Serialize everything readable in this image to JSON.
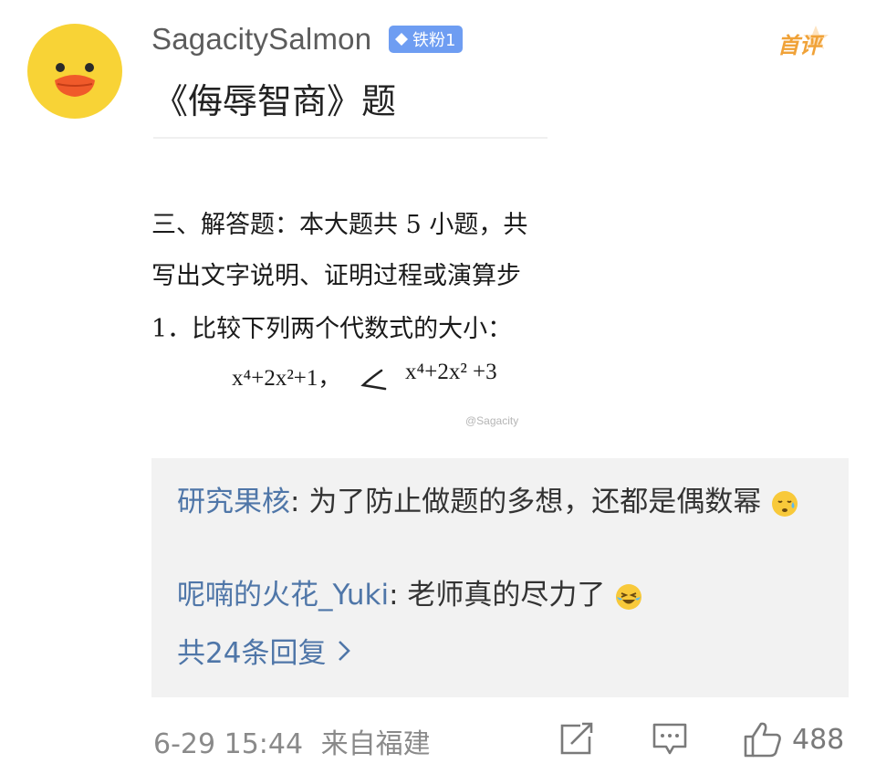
{
  "post": {
    "username": "SagacitySalmon",
    "badge_label": "铁粉1",
    "first_comment_label": "首评",
    "text": "《侮辱智商》题"
  },
  "image": {
    "line1": "三、解答题：本大题共 5 小题，共",
    "line2": "写出文字说明、证明过程或演算步",
    "line3": "1．比较下列两个代数式的大小：",
    "expr_left": "x⁴+2x²+1，",
    "expr_right": "x⁴+2x² +3",
    "watermark": "@Sagacity"
  },
  "replies": [
    {
      "author": "研究果核",
      "text": "为了防止做题的多想，还都是偶数幂"
    },
    {
      "author": "呢喃的火花_Yuki",
      "text": "老师真的尽力了"
    }
  ],
  "more_replies": "共24条回复",
  "footer": {
    "timestamp": "6-29 15:44",
    "source": "来自福建",
    "like_count": "488"
  },
  "colors": {
    "link": "#4f76a8",
    "badge": "#6e9df2",
    "first_comment": "#f0a238",
    "reply_bg": "#f2f2f2"
  }
}
